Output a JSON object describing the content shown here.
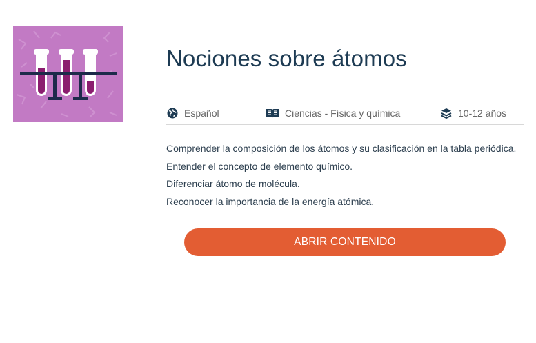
{
  "course": {
    "title": "Nociones sobre átomos",
    "thumbnail_icon": "test-tubes-icon",
    "thumbnail_bg": "#c27ac4"
  },
  "meta": {
    "language": {
      "icon": "globe-icon",
      "label": "Español"
    },
    "subject": {
      "icon": "book-icon",
      "label": "Ciencias - Física y química"
    },
    "age": {
      "icon": "layers-icon",
      "label": "10-12 años"
    }
  },
  "objectives": [
    "Comprender la composición de los átomos y su clasificación en la tabla periódica.",
    "Entender el concepto de elemento químico.",
    "Diferenciar átomo de molécula.",
    "Reconocer la importancia de la energía atómica."
  ],
  "cta": {
    "label": "ABRIR CONTENIDO",
    "color": "#e35d33"
  },
  "colors": {
    "title": "#1d3b53",
    "text": "#2e4050",
    "meta": "#666666"
  }
}
